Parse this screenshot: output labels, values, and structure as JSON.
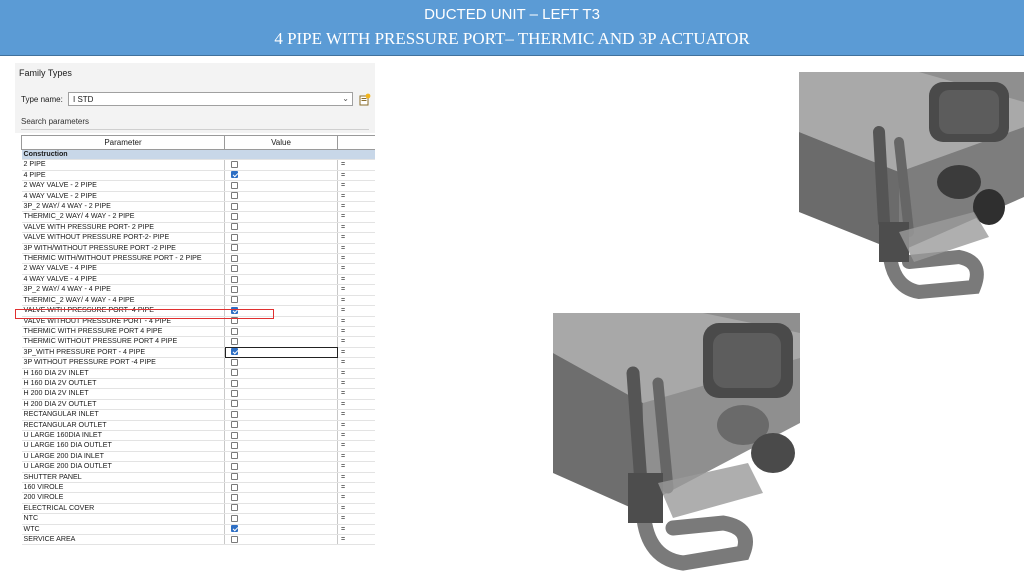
{
  "banner": {
    "line1": "DUCTED UNIT – LEFT T3",
    "line2": "4 PIPE WITH PRESSURE PORT– THERMIC AND  3P ACTUATOR"
  },
  "dialog": {
    "title": "Family Types",
    "type_name_label": "Type name:",
    "type_name_value": "I STD",
    "search_placeholder": "Search parameters",
    "columns": [
      "Parameter",
      "Value",
      ""
    ],
    "group": "Construction",
    "rows": [
      {
        "name": "2 PIPE",
        "checked": false,
        "eq": "="
      },
      {
        "name": "4 PIPE",
        "checked": true,
        "eq": "="
      },
      {
        "name": "2 WAY  VALVE - 2 PIPE",
        "checked": false,
        "eq": "="
      },
      {
        "name": "4 WAY VALVE - 2 PIPE",
        "checked": false,
        "eq": "="
      },
      {
        "name": "3P_2 WAY/ 4 WAY - 2 PIPE",
        "checked": false,
        "eq": "="
      },
      {
        "name": "THERMIC_2 WAY/ 4 WAY - 2 PIPE",
        "checked": false,
        "eq": "="
      },
      {
        "name": "VALVE WITH PRESSURE PORT- 2 PIPE",
        "checked": false,
        "eq": "="
      },
      {
        "name": "VALVE WITHOUT PRESSURE PORT-2- PIPE",
        "checked": false,
        "eq": "="
      },
      {
        "name": "3P WITH/WITHOUT PRESSURE PORT -2 PIPE",
        "checked": false,
        "eq": "="
      },
      {
        "name": "THERMIC WITH/WITHOUT PRESSURE PORT - 2 PIPE",
        "checked": false,
        "eq": "="
      },
      {
        "name": "2 WAY VALVE - 4 PIPE",
        "checked": false,
        "eq": "="
      },
      {
        "name": "4 WAY VALVE - 4 PIPE",
        "checked": false,
        "eq": "="
      },
      {
        "name": "3P_2 WAY/ 4 WAY - 4 PIPE",
        "checked": false,
        "eq": "="
      },
      {
        "name": "THERMIC_2 WAY/ 4 WAY - 4 PIPE",
        "checked": false,
        "eq": "="
      },
      {
        "name": "VALVE WITH PRESSURE PORT- 4 PIPE",
        "checked": true,
        "eq": "=",
        "highlight": true
      },
      {
        "name": "VALVE WITHOUT PRESSURE PORT - 4 PIPE",
        "checked": false,
        "eq": "="
      },
      {
        "name": "THERMIC WITH PRESSURE PORT 4 PIPE",
        "checked": false,
        "eq": "="
      },
      {
        "name": "THERMIC WITHOUT PRESSURE PORT  4 PIPE",
        "checked": false,
        "eq": "="
      },
      {
        "name": "3P_WITH PRESSURE PORT - 4 PIPE",
        "checked": true,
        "eq": "=",
        "editing": true
      },
      {
        "name": "3P WITHOUT PRESSURE PORT -4  PIPE",
        "checked": false,
        "eq": "="
      },
      {
        "name": "H 160 DIA 2V INLET",
        "checked": false,
        "eq": "="
      },
      {
        "name": "H 160 DIA 2V OUTLET",
        "checked": false,
        "eq": "="
      },
      {
        "name": "H 200 DIA 2V INLET",
        "checked": false,
        "eq": "="
      },
      {
        "name": "H 200 DIA 2V OUTLET",
        "checked": false,
        "eq": "="
      },
      {
        "name": "RECTANGULAR INLET",
        "checked": false,
        "eq": "="
      },
      {
        "name": "RECTANGULAR  OUTLET",
        "checked": false,
        "eq": "="
      },
      {
        "name": "U LARGE 160DIA INLET",
        "checked": false,
        "eq": "="
      },
      {
        "name": "U LARGE 160 DIA OUTLET",
        "checked": false,
        "eq": "="
      },
      {
        "name": "U LARGE 200 DIA INLET",
        "checked": false,
        "eq": "="
      },
      {
        "name": "U LARGE 200 DIA OUTLET",
        "checked": false,
        "eq": "="
      },
      {
        "name": "SHUTTER PANEL",
        "checked": false,
        "eq": "="
      },
      {
        "name": "160 VIROLE",
        "checked": false,
        "eq": "="
      },
      {
        "name": "200 VIROLE",
        "checked": false,
        "eq": "="
      },
      {
        "name": "ELECTRICAL COVER",
        "checked": false,
        "eq": "="
      },
      {
        "name": "NTC",
        "checked": false,
        "eq": "="
      },
      {
        "name": "WTC",
        "checked": true,
        "eq": "="
      },
      {
        "name": "SERVICE AREA",
        "checked": false,
        "eq": "="
      }
    ]
  },
  "icons": {
    "dropdown": "chevron-down-icon",
    "new_type": "new-type-icon"
  },
  "colors": {
    "banner": "#5b9bd5",
    "group_row": "#c8d7e8",
    "checkbox_on": "#2e6fc4",
    "highlight_border": "#e03030"
  }
}
